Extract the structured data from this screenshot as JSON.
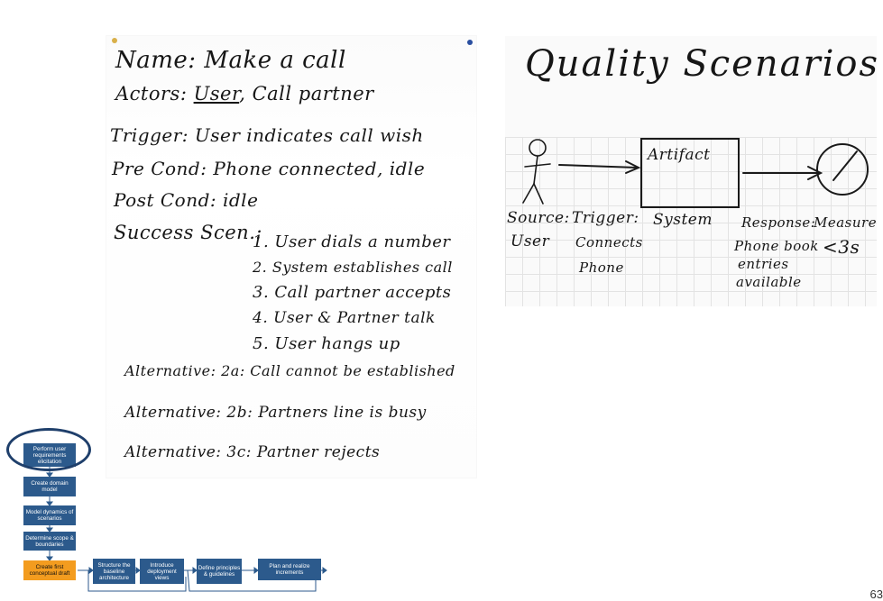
{
  "use_case": {
    "name_line": "Name: Make a call",
    "actors_prefix": "Actors: ",
    "actors_user": "User",
    "actors_rest": ", Call partner",
    "trigger": "Trigger: User indicates call wish",
    "pre_cond": "Pre Cond: Phone connected, idle",
    "post_cond": "Post Cond: idle",
    "success_label": "Success Scen.:",
    "steps": [
      "1. User dials a number",
      "2. System establishes call",
      "3. Call partner accepts",
      "4. User & Partner talk",
      "5. User hangs up"
    ],
    "alternatives": [
      "Alternative: 2a: Call cannot be established",
      "Alternative: 2b: Partners line is busy",
      "Alternative: 3c: Partner rejects"
    ]
  },
  "quality_scenarios": {
    "title": "Quality Scenarios",
    "artifact": "Artifact",
    "source_label": "Source:",
    "source_value": "User",
    "trigger_label": "Trigger:",
    "trigger_value_1": "Connects",
    "trigger_value_2": "Phone",
    "system_label": "System",
    "response_label": "Response:",
    "response_value_1": "Phone book",
    "response_value_2": "entries",
    "response_value_3": "available",
    "measure_label": "Measure",
    "measure_value": "<3s"
  },
  "process_flow": {
    "perform": "Perform user requirements elicitation",
    "domain": "Create domain model",
    "dynamics": "Model dynamics of scenarios",
    "scope": "Determine scope & boundaries",
    "first_draft": "Create first conceptual draft",
    "baseline": "Structure the baseline architecture",
    "deployment": "Introduce deployment views",
    "principles": "Define principles & guidelines",
    "increments": "Plan and realize increments"
  },
  "page_number": "63",
  "colors": {
    "flow_box": "#2c5a8c",
    "flow_active": "#f39c1f",
    "highlight_ring": "#1f3f6b"
  }
}
